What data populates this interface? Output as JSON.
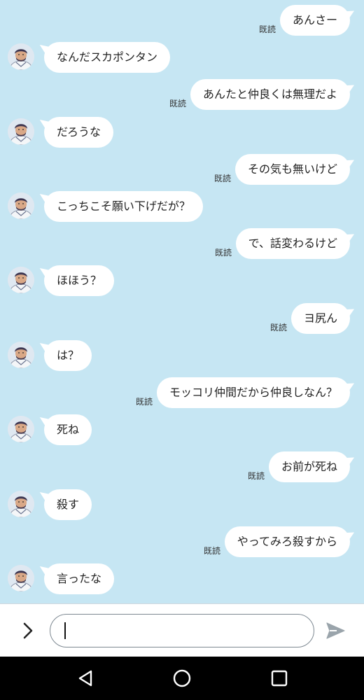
{
  "read_label": "既読",
  "colors": {
    "chat_background": "#c6e6f3",
    "bubble": "#ffffff",
    "composer_background": "#ffffff",
    "navbar_background": "#000000",
    "send_icon": "#9aa4ab"
  },
  "messages": [
    {
      "side": "sent",
      "text": "あんさー",
      "read": true
    },
    {
      "side": "recv",
      "text": "なんだスカポンタン",
      "avatar": "avatar"
    },
    {
      "side": "sent",
      "text": "あんたと仲良くは無理だよ",
      "read": true
    },
    {
      "side": "recv",
      "text": "だろうな",
      "avatar": "avatar"
    },
    {
      "side": "sent",
      "text": "その気も無いけど",
      "read": true
    },
    {
      "side": "recv",
      "text": "こっちこそ願い下げだが？",
      "avatar": "avatar"
    },
    {
      "side": "sent",
      "text": "で、話変わるけど",
      "read": true
    },
    {
      "side": "recv",
      "text": "ほほう？",
      "avatar": "avatar"
    },
    {
      "side": "sent",
      "text": "ヨ尻ん",
      "read": true
    },
    {
      "side": "recv",
      "text": "は？",
      "avatar": "avatar"
    },
    {
      "side": "sent",
      "text": "モッコリ仲間だから仲良しなん？",
      "read": true
    },
    {
      "side": "recv",
      "text": "死ね",
      "avatar": "avatar"
    },
    {
      "side": "sent",
      "text": "お前が死ね",
      "read": true
    },
    {
      "side": "recv",
      "text": "殺す",
      "avatar": "avatar"
    },
    {
      "side": "sent",
      "text": "やってみろ殺すから",
      "read": true
    },
    {
      "side": "recv",
      "text": "言ったな",
      "avatar": "avatar"
    }
  ],
  "composer": {
    "input_value": "",
    "expand_icon": "chevron-right-icon",
    "send_icon": "send-icon"
  },
  "navbar": {
    "back_icon": "back-triangle-icon",
    "home_icon": "home-circle-icon",
    "recents_icon": "recents-square-icon"
  }
}
